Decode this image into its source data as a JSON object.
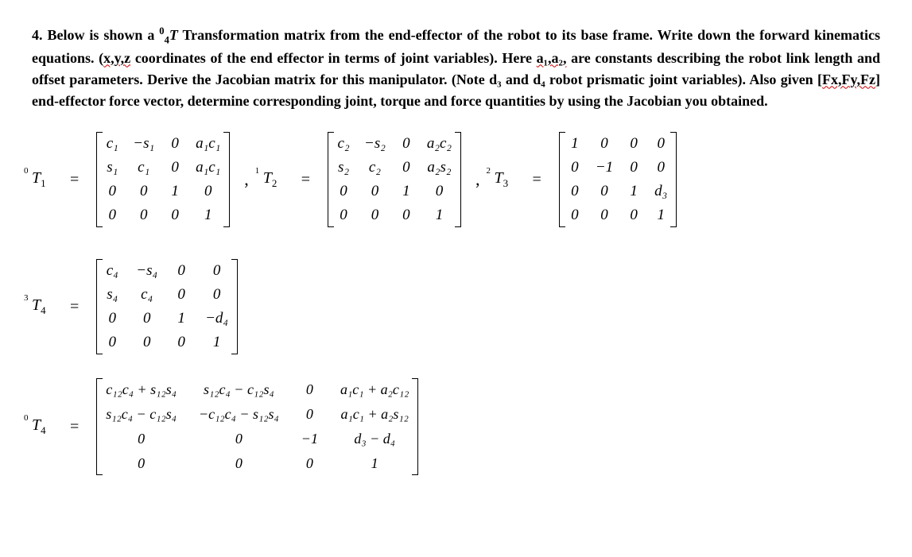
{
  "problem": {
    "q_num": "4. ",
    "p1": "Below is shown a ",
    "t_pre": "0",
    "t_sub": "4",
    "t_letter": "T",
    "p2": " Transformation matrix from the end-effector of the robot to its base frame. Write down the forward kinematics equations. (",
    "xyz": "x,y,z",
    "p3": " coordinates of the end effector in terms of joint variables). Here ",
    "a1a2": "a₁,a₂,",
    "p4": " are constants describing the robot link length and offset parameters. Derive the Jacobian matrix for this manipulator. (Note d₃ and d₄ robot prismatic joint variables). Also given [",
    "fxfy": "Fx,Fy,Fz",
    "p5": "] end-effector force vector, determine corresponding joint, torque and force  quantities by using the Jacobian you obtained."
  },
  "labels": {
    "T1": {
      "pre": "0",
      "T": "T",
      "sub": "1"
    },
    "T2": {
      "pre": "1",
      "T": "T",
      "sub": "2"
    },
    "T3": {
      "pre": "2",
      "T": "T",
      "sub": "3"
    },
    "T4_3": {
      "pre": "3",
      "T": "T",
      "sub": "4"
    },
    "T4_0": {
      "pre": "0",
      "T": "T",
      "sub": "4"
    }
  },
  "m_T1": [
    [
      "c₁",
      "−s₁",
      "0",
      "a₁c₁"
    ],
    [
      "s₁",
      "c₁",
      "0",
      "a₁c₁"
    ],
    [
      "0",
      "0",
      "1",
      "0"
    ],
    [
      "0",
      "0",
      "0",
      "1"
    ]
  ],
  "m_T2": [
    [
      "c₂",
      "−s₂",
      "0",
      "a₂c₂"
    ],
    [
      "s₂",
      "c₂",
      "0",
      "a₂s₂"
    ],
    [
      "0",
      "0",
      "1",
      "0"
    ],
    [
      "0",
      "0",
      "0",
      "1"
    ]
  ],
  "m_T3": [
    [
      "1",
      "0",
      "0",
      "0"
    ],
    [
      "0",
      "−1",
      "0",
      "0"
    ],
    [
      "0",
      "0",
      "1",
      "d₃"
    ],
    [
      "0",
      "0",
      "0",
      "1"
    ]
  ],
  "m_T4_3": [
    [
      "c₄",
      "−s₄",
      "0",
      "0"
    ],
    [
      "s₄",
      "c₄",
      "0",
      "0"
    ],
    [
      "0",
      "0",
      "1",
      "−d₄"
    ],
    [
      "0",
      "0",
      "0",
      "1"
    ]
  ],
  "m_T4_0": [
    [
      "c₁₂c₄ + s₁₂s₄",
      "s₁₂c₄ − c₁₂s₄",
      "0",
      "a₁c₁ + a₂c₁₂"
    ],
    [
      "s₁₂c₄ − c₁₂s₄",
      "−c₁₂c₄ − s₁₂s₄",
      "0",
      "a₁c₁ + a₂s₁₂"
    ],
    [
      "0",
      "0",
      "−1",
      "d₃ − d₄"
    ],
    [
      "0",
      "0",
      "0",
      "1"
    ]
  ],
  "glyphs": {
    "eq": "=",
    "comma": ","
  }
}
